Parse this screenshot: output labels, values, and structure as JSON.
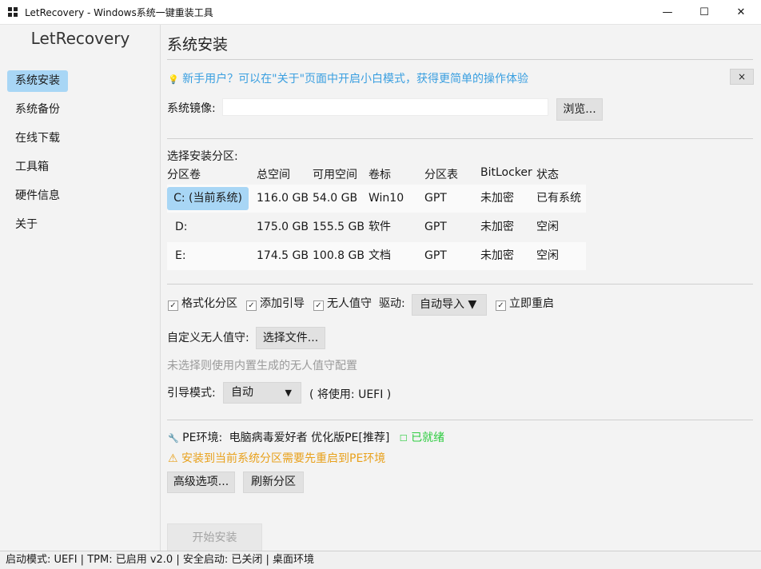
{
  "window": {
    "title": "LetRecovery - Windows系统一键重装工具",
    "minimize": "—",
    "maximize": "☐",
    "close": "✕"
  },
  "sidebar": {
    "brand": "LetRecovery",
    "items": [
      {
        "label": "系统安装",
        "active": true
      },
      {
        "label": "系统备份"
      },
      {
        "label": "在线下载"
      },
      {
        "label": "工具箱"
      },
      {
        "label": "硬件信息"
      },
      {
        "label": "关于"
      }
    ]
  },
  "main": {
    "title": "系统安装",
    "tip": {
      "icon": "💡",
      "text": "新手用户？可以在\"关于\"页面中开启小白模式，获得更简单的操作体验",
      "close": "×"
    },
    "image": {
      "label": "系统镜像:",
      "value": "",
      "browse": "浏览..."
    },
    "partition": {
      "label": "选择安装分区:",
      "columns": [
        "分区卷",
        "总空间",
        "可用空间",
        "卷标",
        "分区表",
        "BitLocker",
        "状态"
      ],
      "rows": [
        {
          "drive": "C: (当前系统)",
          "total": "116.0 GB",
          "free": "54.0 GB",
          "label": "Win10",
          "table": "GPT",
          "bitlocker": "未加密",
          "status": "已有系统",
          "selected": true
        },
        {
          "drive": "D:",
          "total": "175.0 GB",
          "free": "155.5 GB",
          "label": "软件",
          "table": "GPT",
          "bitlocker": "未加密",
          "status": "空闲"
        },
        {
          "drive": "E:",
          "total": "174.5 GB",
          "free": "100.8 GB",
          "label": "文档",
          "table": "GPT",
          "bitlocker": "未加密",
          "status": "空闲"
        }
      ]
    },
    "options": {
      "format": "格式化分区",
      "add_boot": "添加引导",
      "unattended": "无人值守",
      "driver_label": "驱动:",
      "driver_value": "自动导入 ▼",
      "reboot": "立即重启",
      "check_mark": "✓"
    },
    "custom_unattend": {
      "label": "自定义无人值守:",
      "button": "选择文件...",
      "hint": "未选择则使用内置生成的无人值守配置"
    },
    "boot_mode": {
      "label": "引导模式:",
      "value": "自动",
      "arrow": "▼",
      "note": "( 将使用: UEFI )"
    },
    "pe": {
      "icon": "🔧",
      "label": "PE环境:",
      "name": "电脑病毒爱好者 优化版PE[推荐]",
      "status_icon": "☐",
      "status": "已就绪",
      "warning": "⚠ 安装到当前系统分区需要先重启到PE环境"
    },
    "buttons": {
      "advanced": "高级选项...",
      "refresh": "刷新分区",
      "start": "开始安装"
    }
  },
  "statusbar": {
    "text": "启动模式: UEFI | TPM: 已启用 v2.0 | 安全启动: 已关闭 | 桌面环境"
  },
  "colors": {
    "accent": "#a8d6f5",
    "tip": "#3a9fe0",
    "warning": "#e8a11c",
    "ready": "#2ecc40"
  }
}
